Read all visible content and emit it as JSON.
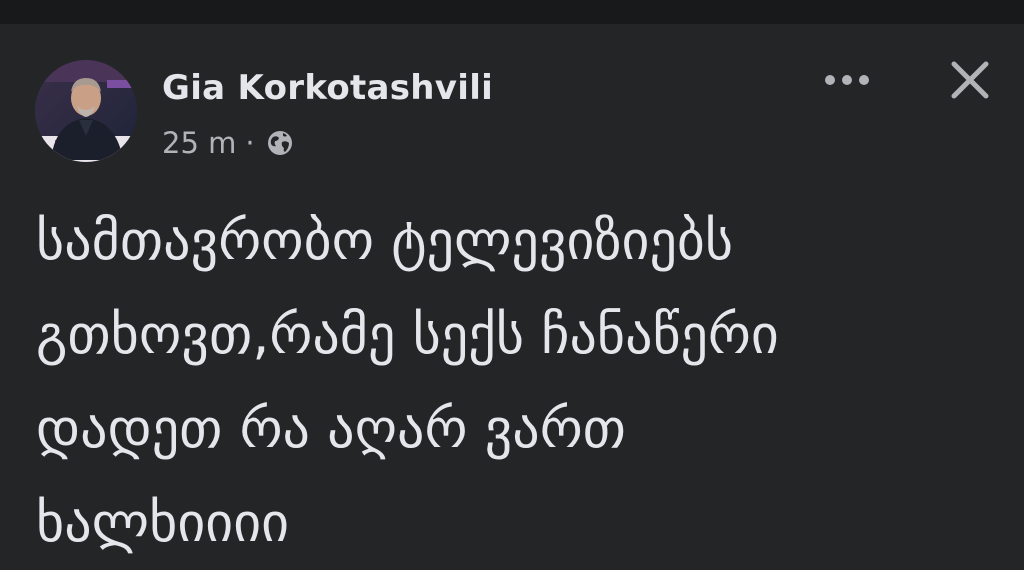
{
  "post": {
    "author": "Gia Korkotashvili",
    "time": "25 m",
    "separator": "·",
    "privacy_icon": "globe-icon",
    "actions": {
      "more_icon": "more-options-icon",
      "close_icon": "close-icon"
    },
    "text_lines": [
      "სამთავრობო ტელევიზიებს",
      "გთხოვთ,რამე სექს ჩანაწერი",
      "დადეთ რა აღარ ვართ",
      "ხალხიიიი"
    ]
  },
  "colors": {
    "background": "#242526",
    "topbar": "#18191a",
    "primary_text": "#e4e6eb",
    "secondary_text": "#b0b3b8"
  }
}
